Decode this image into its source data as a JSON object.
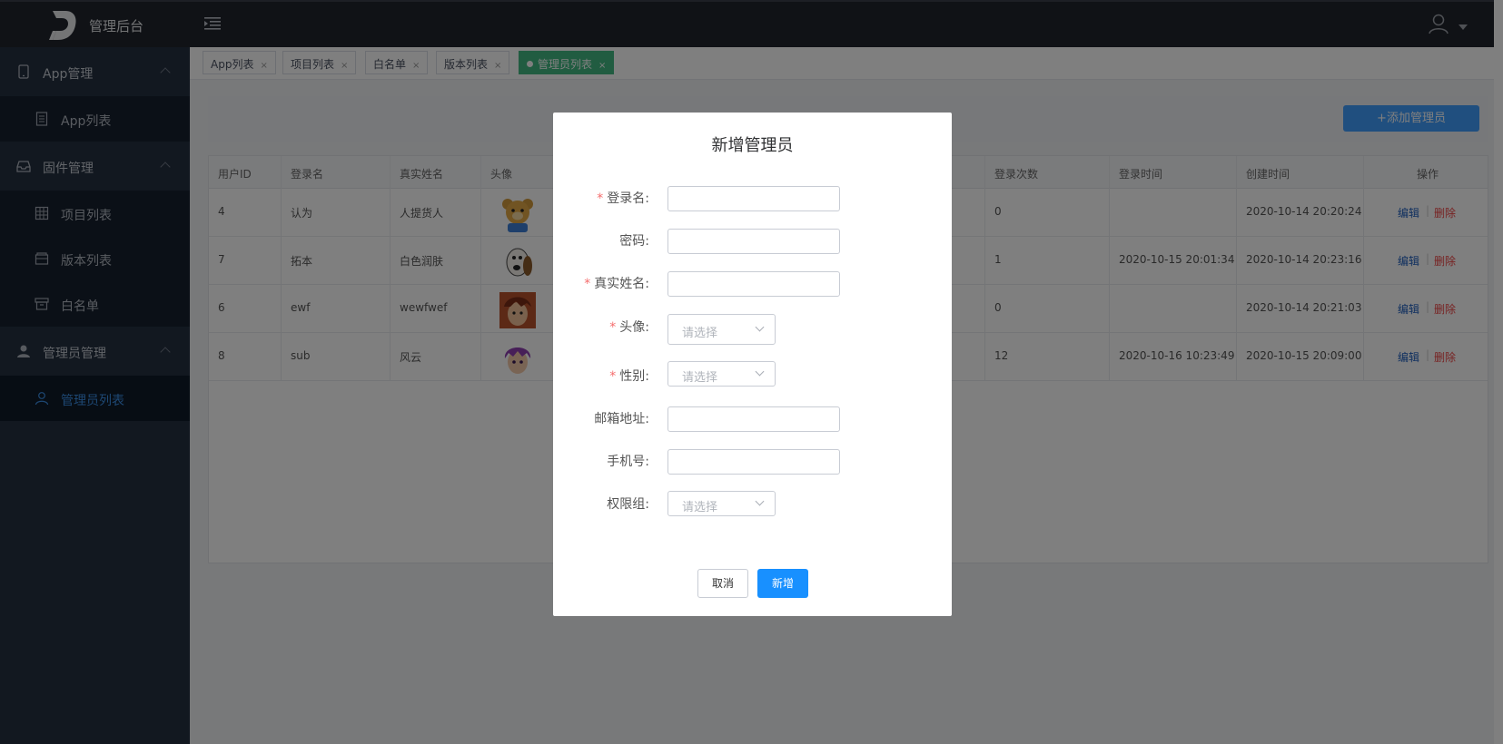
{
  "header": {
    "brand": "管理后台"
  },
  "sidebar": {
    "groups": [
      {
        "label": "App管理",
        "items": [
          {
            "label": "App列表"
          }
        ]
      },
      {
        "label": "固件管理",
        "items": [
          {
            "label": "项目列表"
          },
          {
            "label": "版本列表"
          },
          {
            "label": "白名单"
          }
        ]
      },
      {
        "label": "管理员管理",
        "items": [
          {
            "label": "管理员列表"
          }
        ]
      }
    ]
  },
  "tabs": [
    {
      "label": "App列表",
      "close": "×"
    },
    {
      "label": "项目列表",
      "close": "×"
    },
    {
      "label": "白名单",
      "close": "×"
    },
    {
      "label": "版本列表",
      "close": "×"
    },
    {
      "label": "管理员列表",
      "close": "×"
    }
  ],
  "toolbar": {
    "add_label": "+添加管理员"
  },
  "table": {
    "columns": [
      "用户ID",
      "登录名",
      "真实姓名",
      "头像",
      "登录次数",
      "登录时间",
      "创建时间",
      "操作"
    ],
    "rows": [
      {
        "id": "4",
        "login": "认为",
        "name": "人提货人",
        "count": "0",
        "login_time": "",
        "created": "2020-10-14 20:20:24"
      },
      {
        "id": "7",
        "login": "拓本",
        "name": "白色润肤",
        "count": "1",
        "login_time": "2020-10-15 20:01:34",
        "created": "2020-10-14 20:23:16"
      },
      {
        "id": "6",
        "login": "ewf",
        "name": "wewfwef",
        "count": "0",
        "login_time": "",
        "created": "2020-10-14 20:21:03"
      },
      {
        "id": "8",
        "login": "sub",
        "name": "风云",
        "count": "12",
        "login_time": "2020-10-16 10:23:49",
        "created": "2020-10-15 20:09:00"
      }
    ],
    "ops": {
      "edit": "编辑",
      "sep": "|",
      "delete": "删除"
    }
  },
  "modal": {
    "title": "新增管理员",
    "fields": {
      "login": {
        "label": "登录名:",
        "required": "*"
      },
      "password": {
        "label": "密码:"
      },
      "realname": {
        "label": "真实姓名:",
        "required": "*"
      },
      "avatar": {
        "label": "头像:",
        "required": "*",
        "placeholder": "请选择"
      },
      "gender": {
        "label": "性别:",
        "required": "*",
        "placeholder": "请选择"
      },
      "email": {
        "label": "邮箱地址:"
      },
      "phone": {
        "label": "手机号:"
      },
      "group": {
        "label": "权限组:",
        "placeholder": "请选择"
      }
    },
    "cancel_label": "取消",
    "submit_label": "新增"
  },
  "colors": {
    "primary": "#409eff",
    "active_tab": "#42b983",
    "danger": "#ee4444",
    "sidebar_bg": "#243040",
    "topbar_bg": "#20242d"
  }
}
